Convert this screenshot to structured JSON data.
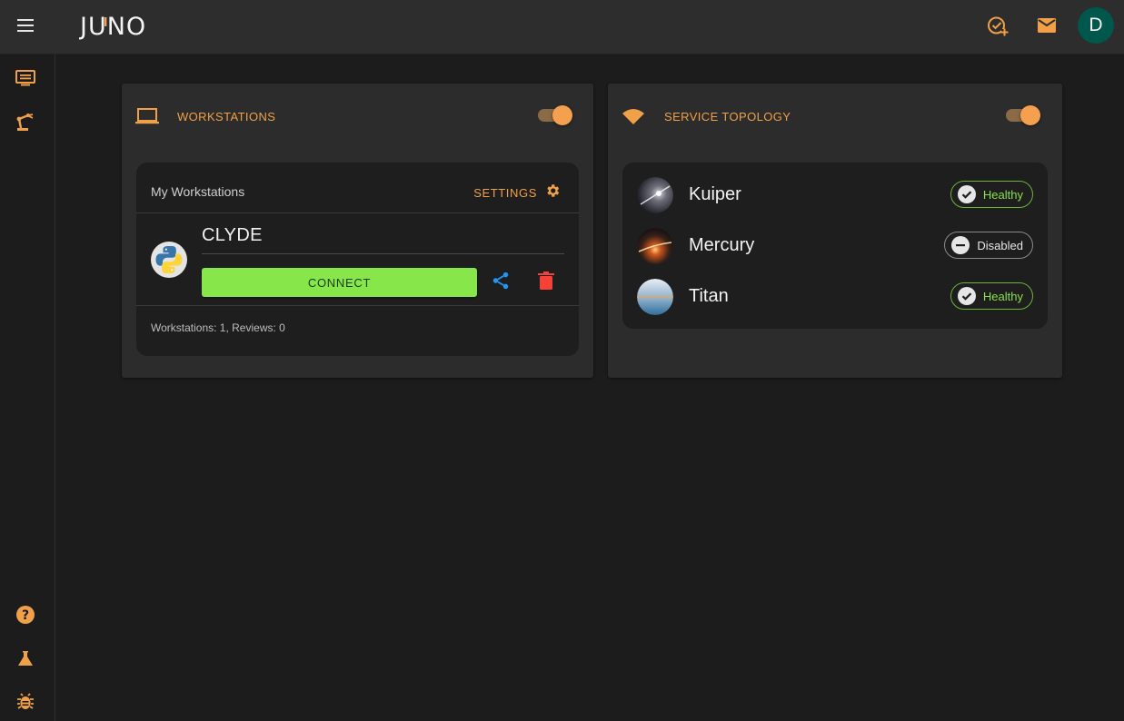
{
  "app": {
    "logo_text": "JUNO",
    "user_initial": "D"
  },
  "colors": {
    "accent": "#f0a048",
    "connect": "#86e64a",
    "healthy": "#8be04e",
    "delete": "#f44336",
    "share": "#2196f3",
    "avatar": "#00574b"
  },
  "topbar": {
    "icons": [
      "menu-icon",
      "task-add-icon",
      "mail-icon"
    ]
  },
  "rail": {
    "items": [
      "list-icon",
      "robot-arm-icon",
      "help-icon",
      "flask-icon",
      "bug-icon"
    ]
  },
  "workstations_card": {
    "title": "WORKSTATIONS",
    "enabled": true,
    "panel_title": "My Workstations",
    "settings_label": "SETTINGS",
    "workstation": {
      "name": "CLYDE",
      "connect_label": "CONNECT"
    },
    "footer": "Workstations: 1, Reviews: 0"
  },
  "topology_card": {
    "title": "SERVICE TOPOLOGY",
    "enabled": true,
    "services": [
      {
        "name": "Kuiper",
        "status": "Healthy"
      },
      {
        "name": "Mercury",
        "status": "Disabled"
      },
      {
        "name": "Titan",
        "status": "Healthy"
      }
    ]
  }
}
